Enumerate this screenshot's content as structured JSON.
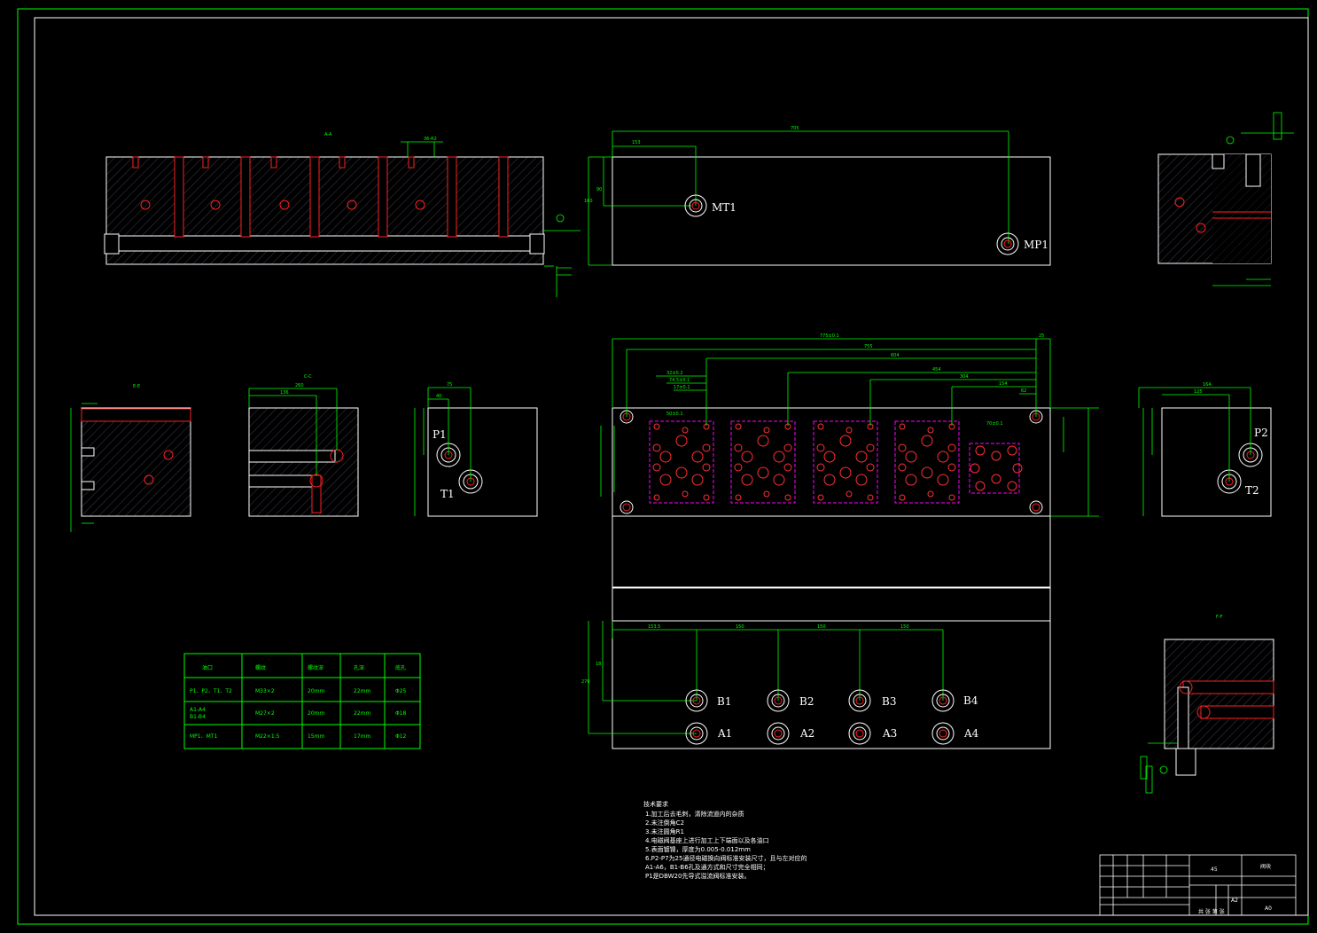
{
  "colors": {
    "background": "#000000",
    "frame": "#00ff00",
    "outline": "#ffffff",
    "dimension": "#00ff00",
    "hidden": "#ff2020",
    "port": "#ff3030",
    "valve_outline": "#ff00ff",
    "hatch": "#3a3a50"
  },
  "views": {
    "section_aa": "A-A",
    "section_cc": "C-C",
    "section_ee": "E-E",
    "section_ff": "F-F"
  },
  "ports": {
    "mt1": "MT1",
    "mp1": "MP1",
    "p1": "P1",
    "t1": "T1",
    "p2": "P2",
    "t2": "T2",
    "b1": "B1",
    "b2": "B2",
    "b3": "B3",
    "b4": "B4",
    "a1": "A1",
    "a2": "A2",
    "a3": "A3",
    "a4": "A4"
  },
  "dims": {
    "top_overall": "705",
    "top_left": "153",
    "top_h": "90",
    "top_h2": "160",
    "main_overall": "775±0.1",
    "main_755": "755",
    "main_604": "604",
    "main_454": "454",
    "main_304": "304",
    "main_154": "154",
    "main_62": "62",
    "main_25": "25",
    "main_32": "32±0.2",
    "main_74": "74.5±0.1",
    "main_17": "17±0.1",
    "main_50": "50±0.1",
    "main_70": "70±0.1",
    "bottom_153": "153.5",
    "bottom_150a": "150",
    "bottom_150b": "150",
    "bottom_150c": "150",
    "bottom_h": "270",
    "bottom_h2": "18",
    "cc_260": "260",
    "cc_136": "136",
    "p1_75": "75",
    "p1_40": "40",
    "p2_164": "164",
    "p2_125": "125"
  },
  "port_table": {
    "headers": [
      "油口",
      "螺纹",
      "螺纹深",
      "孔深",
      "底孔"
    ],
    "rows": [
      [
        "P1、P2、T1、T2",
        "M33×2",
        "20mm",
        "22mm",
        "Φ25"
      ],
      [
        "A1-A4\nB1-B4",
        "M27×2",
        "20mm",
        "22mm",
        "Φ18"
      ],
      [
        "MP1、MT1",
        "M22×1.5",
        "15mm",
        "17mm",
        "Φ12"
      ]
    ]
  },
  "tech_notes": {
    "title": "技术要求",
    "lines": [
      "1.加工后去毛刺，清除流道内的杂质",
      "2.未注倒角C2",
      "3.未注圆角R1",
      "4.电磁阀基座上进行加工上下端面以及各油口",
      "5.表面镀镍，厚度为0.005-0.012mm",
      "6.P2-P7为25通径电磁换向阀标准安装尺寸，且与左对应的",
      "A1-A6，B1-B6孔及通方式和尺寸完全相同；",
      "P1是DBW20先导式溢流阀标准安装。"
    ]
  },
  "title_block": {
    "material": "45",
    "name": "阀块",
    "scale": "A2",
    "sheet": "A0",
    "sign": "共 张 第 张"
  }
}
